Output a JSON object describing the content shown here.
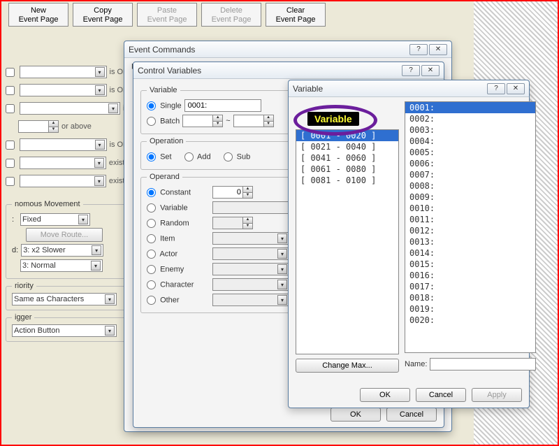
{
  "toolbar": {
    "new": "New\nEvent Page",
    "copy": "Copy\nEvent Page",
    "paste": "Paste\nEvent Page",
    "delete": "Delete\nEvent Page",
    "clear": "Clear\nEvent Page"
  },
  "conditions": {
    "on1": "is ON",
    "on2": "is ON",
    "is": "is",
    "orabove": "or above",
    "on3": "is ON",
    "exists1": "exists",
    "exists2": "exists"
  },
  "movement": {
    "legend": "nomous Movement",
    "fixed": "Fixed",
    "route_btn": "Move Route...",
    "speed_lbl": "d:",
    "speed_val": "3: x2 Slower",
    "freq_val": "3: Normal"
  },
  "priority": {
    "legend": "riority",
    "value": "Same as Characters"
  },
  "trigger": {
    "legend": "igger",
    "value": "Action Button"
  },
  "win_ec": {
    "title": "Event Commands",
    "list_label": "Lis"
  },
  "win_cv": {
    "title": "Control Variables",
    "variable_legend": "Variable",
    "single": "Single",
    "batch": "Batch",
    "single_val": "0001:",
    "tilde": "~",
    "operation_legend": "Operation",
    "op_set": "Set",
    "op_add": "Add",
    "op_sub": "Sub",
    "operand_legend": "Operand",
    "opd": {
      "constant": "Constant",
      "variable": "Variable",
      "random": "Random",
      "item": "Item",
      "actor": "Actor",
      "enemy": "Enemy",
      "character": "Character",
      "other": "Other"
    },
    "const_val": "0",
    "ok": "OK",
    "cancel": "Cancel"
  },
  "win_var": {
    "title": "Variable",
    "ranges": [
      "[ 0001 - 0020 ]",
      "[ 0021 - 0040 ]",
      "[ 0041 - 0060 ]",
      "[ 0061 - 0080 ]",
      "[ 0081 - 0100 ]"
    ],
    "vars": [
      "0001:",
      "0002:",
      "0003:",
      "0004:",
      "0005:",
      "0006:",
      "0007:",
      "0008:",
      "0009:",
      "0010:",
      "0011:",
      "0012:",
      "0013:",
      "0014:",
      "0015:",
      "0016:",
      "0017:",
      "0018:",
      "0019:",
      "0020:"
    ],
    "change_max": "Change Max...",
    "name_lbl": "Name:",
    "ok": "OK",
    "cancel": "Cancel",
    "apply": "Apply"
  },
  "anno_text": "Variable"
}
